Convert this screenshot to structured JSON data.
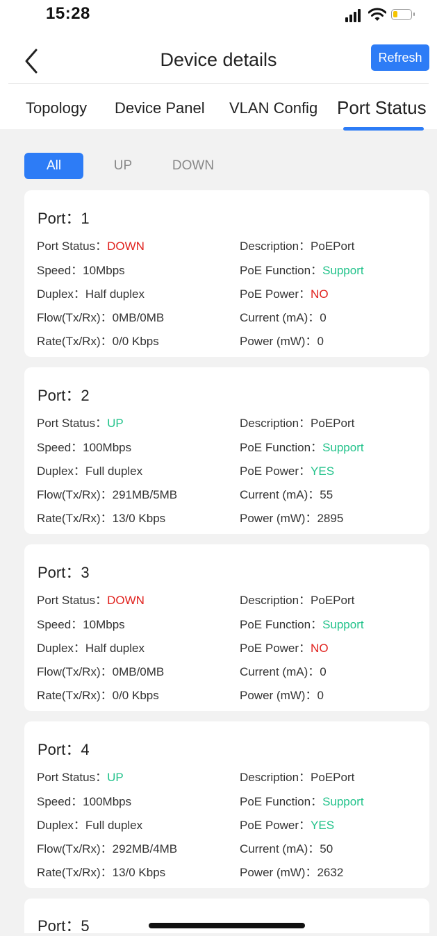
{
  "status_bar": {
    "time": "15:28",
    "icons": [
      "signal-icon",
      "wifi-icon",
      "battery-icon"
    ]
  },
  "header": {
    "title": "Device details",
    "refresh_label": "Refresh"
  },
  "tabs": [
    {
      "label": "Topology",
      "active": false
    },
    {
      "label": "Device Panel",
      "active": false
    },
    {
      "label": "VLAN Config",
      "active": false
    },
    {
      "label": "Port Status",
      "active": true
    }
  ],
  "filters": [
    {
      "label": "All",
      "active": true
    },
    {
      "label": "UP",
      "active": false
    },
    {
      "label": "DOWN",
      "active": false
    }
  ],
  "colors": {
    "accent": "#2d7cf6",
    "up": "#21c28a",
    "down": "#e0201c"
  },
  "labels": {
    "port": "Port：",
    "port_status": "Port Status：",
    "speed": "Speed：",
    "duplex": "Duplex：",
    "flow": "Flow(Tx/Rx)：",
    "rate": "Rate(Tx/Rx)：",
    "description": "Description：",
    "poe_function": "PoE Function：",
    "poe_power": "PoE Power：",
    "current": "Current (mA)：",
    "power": "Power (mW)："
  },
  "ports": [
    {
      "port": "1",
      "status": "DOWN",
      "speed": "10Mbps",
      "duplex": "Half duplex",
      "flow": "0MB/0MB",
      "rate": "0/0 Kbps",
      "description": "PoEPort",
      "poe_function": "Support",
      "poe_power": "NO",
      "current": "0",
      "power": "0"
    },
    {
      "port": "2",
      "status": "UP",
      "speed": "100Mbps",
      "duplex": "Full duplex",
      "flow": "291MB/5MB",
      "rate": "13/0 Kbps",
      "description": "PoEPort",
      "poe_function": "Support",
      "poe_power": "YES",
      "current": "55",
      "power": "2895"
    },
    {
      "port": "3",
      "status": "DOWN",
      "speed": "10Mbps",
      "duplex": "Half duplex",
      "flow": "0MB/0MB",
      "rate": "0/0 Kbps",
      "description": "PoEPort",
      "poe_function": "Support",
      "poe_power": "NO",
      "current": "0",
      "power": "0"
    },
    {
      "port": "4",
      "status": "UP",
      "speed": "100Mbps",
      "duplex": "Full duplex",
      "flow": "292MB/4MB",
      "rate": "13/0 Kbps",
      "description": "PoEPort",
      "poe_function": "Support",
      "poe_power": "YES",
      "current": "50",
      "power": "2632"
    },
    {
      "port": "5"
    }
  ]
}
